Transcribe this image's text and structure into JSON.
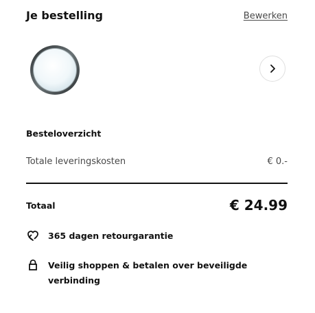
{
  "order": {
    "title": "Je bestelling",
    "edit_label": "Bewerken"
  },
  "product": {
    "thumbnail_icon": "round-mirror-icon",
    "next_icon": "chevron-right-icon"
  },
  "summary": {
    "heading": "Besteloverzicht",
    "delivery_label": "Totale leveringskosten",
    "delivery_value": "€ 0.-",
    "total_label": "Totaal",
    "total_value": "€ 24.99"
  },
  "features": {
    "returns_icon": "return-guarantee-icon",
    "returns_text": "365 dagen retourgarantie",
    "secure_icon": "lock-icon",
    "secure_text": "Veilig shoppen & betalen over beveiligde verbinding"
  },
  "colors": {
    "text_primary": "#111111",
    "text_secondary": "#484848",
    "border": "#dfdfdf"
  }
}
